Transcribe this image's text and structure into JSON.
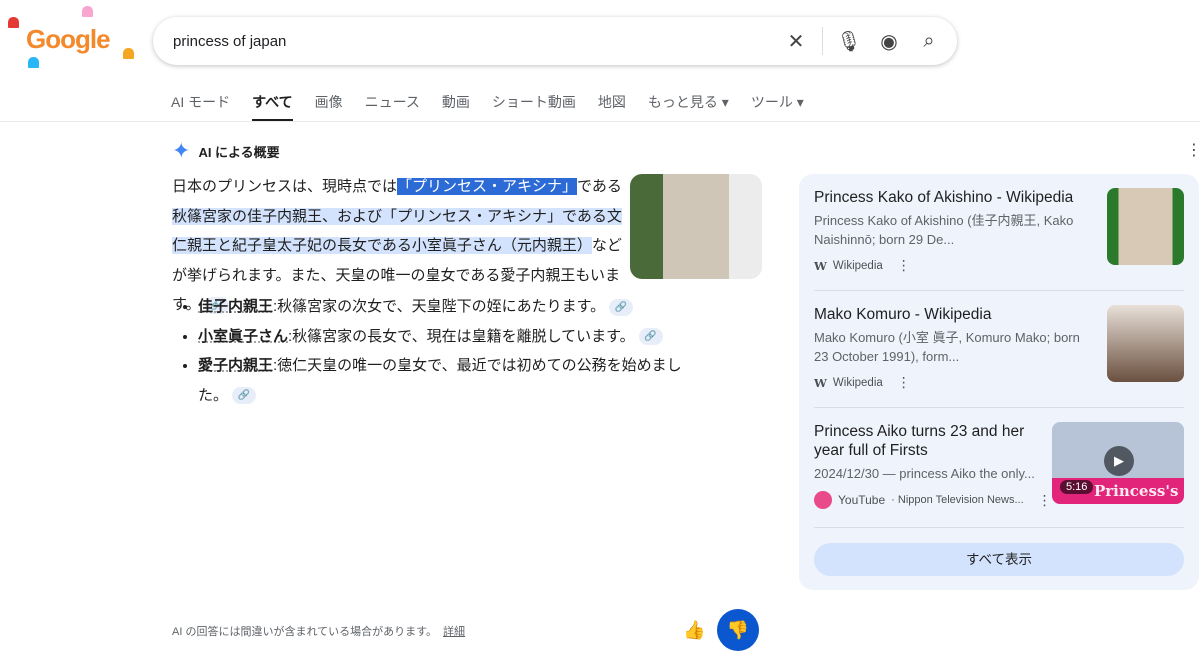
{
  "logo": "Google",
  "search": {
    "query": "princess of japan"
  },
  "tabs": [
    "AI モード",
    "すべて",
    "画像",
    "ニュース",
    "動画",
    "ショート動画",
    "地図",
    "もっと見る ▾",
    "ツール ▾"
  ],
  "ai": {
    "title": "AI による概要",
    "p_pre": "日本のプリンセスは、現時点では",
    "p_hl1": "「プリンセス・アキシナ」",
    "p_mid": "である",
    "p_hl2": "秋篠宮家の佳子内親王、および「プリンセス・アキシナ」である文仁親王と紀子皇太子妃の長女である小室眞子さん（元内親王）",
    "p_post": "などが挙げられます。また、天皇の唯一の皇女である愛子内親王もいます。",
    "bullets": [
      {
        "term": "佳子内親王",
        "text": ":秋篠宮家の次女で、天皇陛下の姪にあたります。"
      },
      {
        "term": "小室眞子さん",
        "text": ":秋篠宮家の長女で、現在は皇籍を離脱しています。"
      },
      {
        "term": "愛子内親王",
        "text": ":徳仁天皇の唯一の皇女で、最近では初めての公務を始めました。"
      }
    ],
    "disclaimer": "AI の回答には間違いが含まれている場合があります。",
    "details": "詳細"
  },
  "sources": [
    {
      "title": "Princess Kako of Akishino - Wikipedia",
      "desc": "Princess Kako of Akishino (佳子内親王, Kako Naishinnō; born 29 De...",
      "site": "Wikipedia"
    },
    {
      "title": "Mako Komuro - Wikipedia",
      "desc": "Mako Komuro (小室 眞子, Komuro Mako; born 23 October 1991), form...",
      "site": "Wikipedia"
    },
    {
      "title": "Princess Aiko turns 23 and her year full of Firsts",
      "desc": "2024/12/30 — princess Aiko the only...",
      "site": "YouTube",
      "channel": "· Nippon Television News...",
      "duration": "5:16",
      "thumb_text": "Princess's Firsts"
    }
  ],
  "show_all": "すべて表示"
}
